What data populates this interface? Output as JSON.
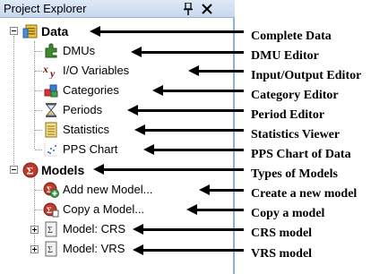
{
  "panel": {
    "title": "Project Explorer",
    "pin_icon": "pin-icon",
    "close_icon": "close-icon"
  },
  "tree": {
    "data": {
      "label": "Data",
      "icon": "database-icon"
    },
    "data_children": [
      {
        "label": "DMUs",
        "icon": "puzzle-icon"
      },
      {
        "label": "I/O Variables",
        "icon": "variables-xy-icon"
      },
      {
        "label": "Categories",
        "icon": "categories-icon"
      },
      {
        "label": "Periods",
        "icon": "hourglass-icon"
      },
      {
        "label": "Statistics",
        "icon": "statistics-icon"
      },
      {
        "label": "PPS Chart",
        "icon": "scatter-chart-icon"
      }
    ],
    "models": {
      "label": "Models",
      "icon": "sigma-icon"
    },
    "models_children": [
      {
        "label": "Add new Model...",
        "icon": "add-model-icon"
      },
      {
        "label": "Copy a Model...",
        "icon": "copy-model-icon"
      },
      {
        "label": "Model: CRS",
        "icon": "model-icon"
      },
      {
        "label": "Model: VRS",
        "icon": "model-icon"
      }
    ]
  },
  "annotations": [
    "Complete Data",
    "DMU Editor",
    "Input/Output Editor",
    "Category Editor",
    "Period Editor",
    "Statistics Viewer",
    "PPS Chart of Data",
    "Types of Models",
    "Create a new model",
    "Copy a model",
    "CRS model",
    "VRS model"
  ],
  "colors": {
    "titlebar": "#c7d8ee",
    "panel_border": "#8fb0d6",
    "data_icon": "#f0c040",
    "models_icon": "#c0392b"
  }
}
